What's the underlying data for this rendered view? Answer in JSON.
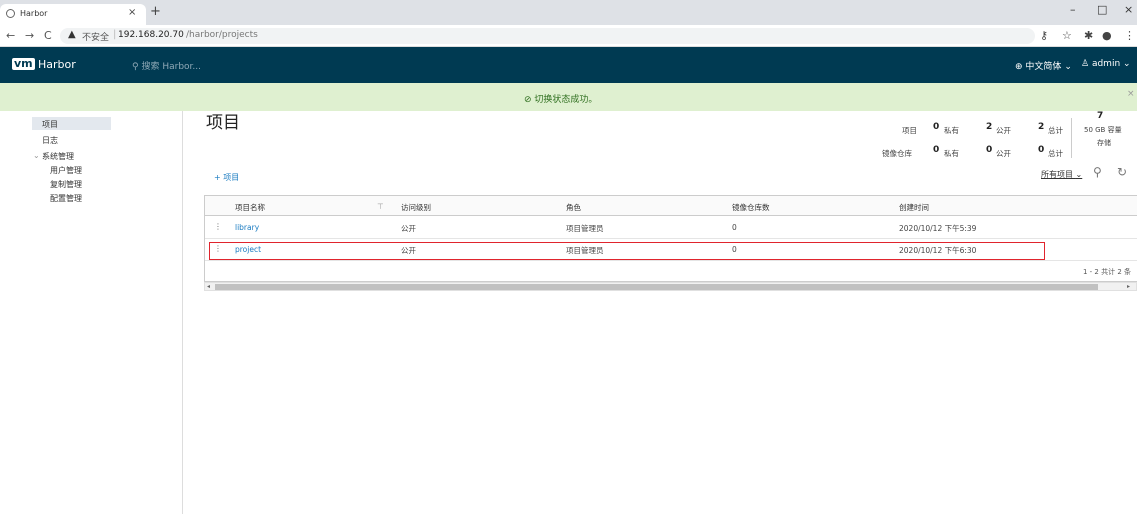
{
  "browser": {
    "tab_title": "Harbor",
    "tab_close": "×",
    "new_tab": "+",
    "window_controls": [
      "–",
      "□",
      "×"
    ],
    "nav": {
      "back": "←",
      "forward": "→",
      "reload": "C"
    },
    "security_label": "不安全",
    "url_host": "192.168.20.70",
    "url_path": "/harbor/projects"
  },
  "header": {
    "logo": "vm",
    "app_name": "Harbor",
    "search_placeholder": "搜索 Harbor...",
    "language": "中文简体",
    "user": "admin"
  },
  "alert": {
    "message": "切换状态成功。",
    "close": "×",
    "color": "#dff0d0"
  },
  "sidebar": {
    "items": [
      {
        "label": "项目",
        "active": true
      },
      {
        "label": "日志"
      },
      {
        "label": "系统管理"
      },
      {
        "label": "用户管理"
      },
      {
        "label": "复制管理"
      },
      {
        "label": "配置管理"
      }
    ]
  },
  "page": {
    "title": "项目",
    "stats": {
      "row1_label": "项目",
      "row2_label": "镜像仓库",
      "private_label": "私有",
      "public_label": "公开",
      "total_label": "总计",
      "projects_private": "0",
      "projects_public": "2",
      "projects_total": "2",
      "repos_private": "0",
      "repos_public": "0",
      "repos_total": "0",
      "quota_value": "7",
      "quota_capacity": "50 GB 容量",
      "quota_label": "存储"
    },
    "add_project": "+ 项目",
    "filter": "所有项目"
  },
  "table": {
    "columns": [
      "项目名称",
      "访问级别",
      "角色",
      "镜像仓库数",
      "创建时间"
    ],
    "rows": [
      {
        "name": "library",
        "access": "公开",
        "role": "项目管理员",
        "repos": "0",
        "created": "2020/10/12 下午5:39"
      },
      {
        "name": "project",
        "access": "公开",
        "role": "项目管理员",
        "repos": "0",
        "created": "2020/10/12 下午6:30"
      }
    ],
    "pagination": "1 - 2 共计 2 条"
  },
  "colors": {
    "header": "#003a52",
    "link": "#1a7bc1",
    "highlight": "#e0242d"
  }
}
